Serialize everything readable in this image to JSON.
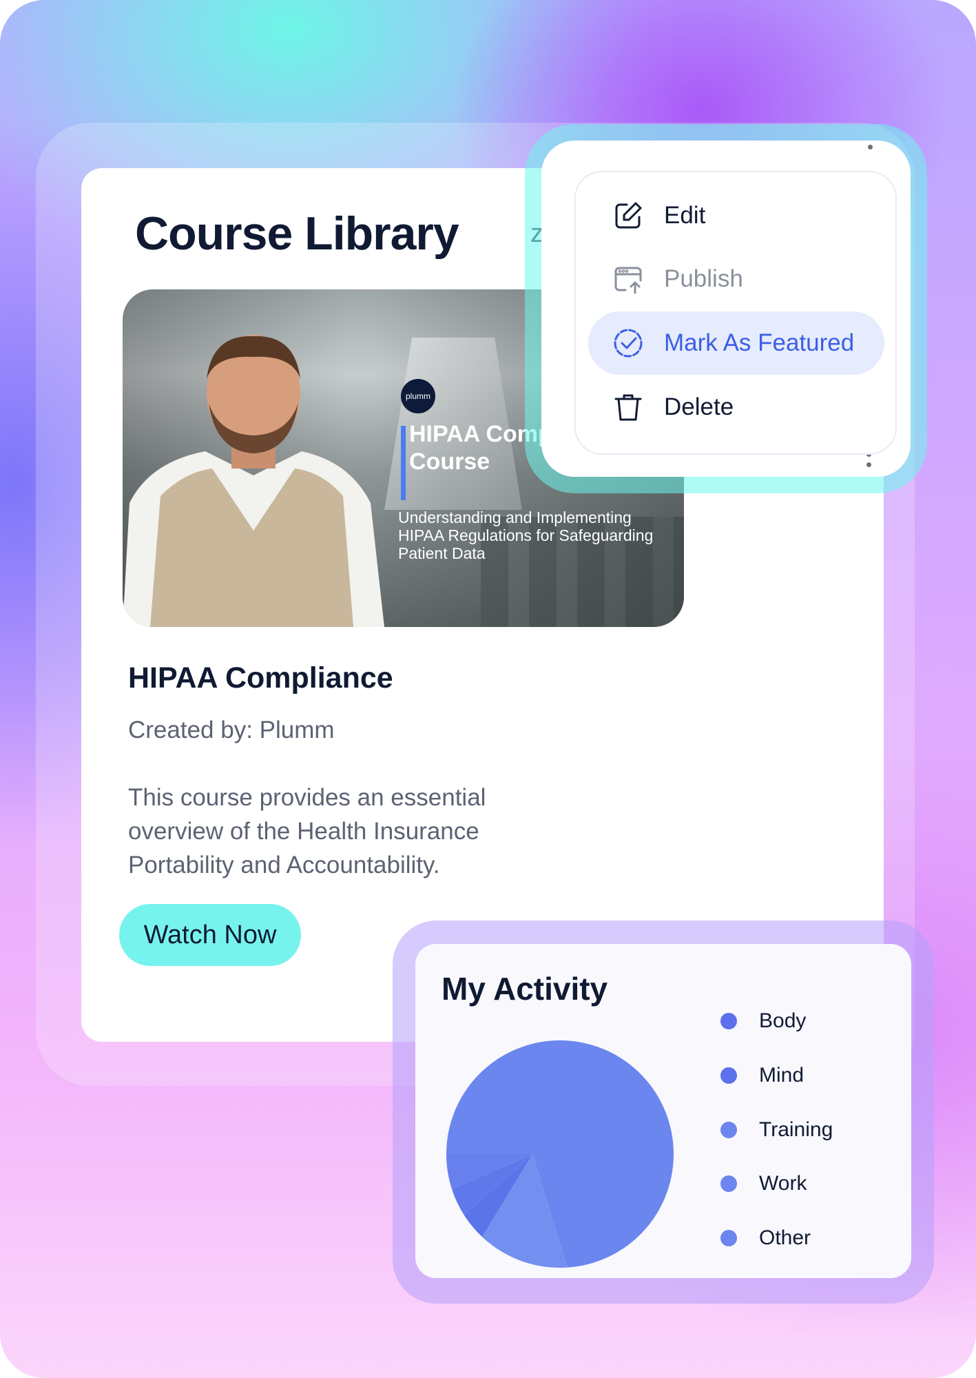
{
  "library": {
    "title": "Course Library",
    "tab_fragment": "zati"
  },
  "course": {
    "thumbnail": {
      "logo_text": "plumm",
      "title": "HIPAA Compliance Course",
      "subtitle": "Understanding and Implementing HIPAA Regulations for Safeguarding Patient Data"
    },
    "name": "HIPAA Compliance",
    "creator": "Created by: Plumm",
    "description": "This course provides an essential overview of the Health Insurance Portability and Accountability.",
    "watch_label": "Watch Now"
  },
  "context_menu": {
    "items": [
      {
        "label": "Edit",
        "icon": "edit-icon",
        "state": "normal"
      },
      {
        "label": "Publish",
        "icon": "publish-icon",
        "state": "disabled"
      },
      {
        "label": "Mark As Featured",
        "icon": "featured-check-icon",
        "state": "highlighted"
      },
      {
        "label": "Delete",
        "icon": "trash-icon",
        "state": "normal"
      }
    ]
  },
  "activity": {
    "title": "My Activity",
    "legend": [
      {
        "label": "Body",
        "color": "#5b70ea"
      },
      {
        "label": "Mind",
        "color": "#5b70ea"
      },
      {
        "label": "Training",
        "color": "#6c85ef"
      },
      {
        "label": "Work",
        "color": "#6c85ef"
      },
      {
        "label": "Other",
        "color": "#6c85ef"
      }
    ]
  },
  "chart_data": {
    "type": "pie",
    "title": "My Activity",
    "categories": [
      "Body",
      "Mind",
      "Training",
      "Work",
      "Other"
    ],
    "values": [
      74,
      13,
      4,
      4,
      5
    ],
    "colors": [
      "#6b86ee",
      "#7390f0",
      "#5a74ea",
      "#5f79eb",
      "#6780ed"
    ]
  }
}
